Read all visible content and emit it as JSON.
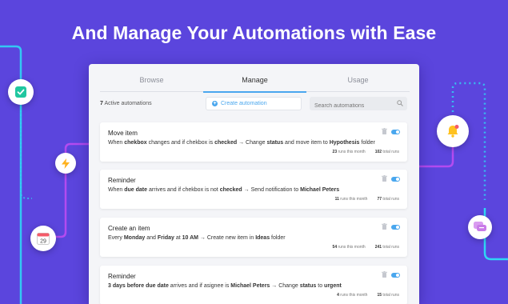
{
  "headline": "And Manage Your Automations with Ease",
  "tabs": [
    "Browse",
    "Manage",
    "Usage"
  ],
  "active_tab": "Manage",
  "count": {
    "number": "7",
    "label": " Active automations"
  },
  "create_label": "Create automation",
  "search_placeholder": "Search automations",
  "calendar_day": "29",
  "cards": [
    {
      "title": "Move item",
      "parts": [
        {
          "t": "When "
        },
        {
          "t": "chekbox",
          "b": true
        },
        {
          "t": " changes and if chekbox is "
        },
        {
          "t": "checked",
          "b": true
        },
        {
          "t": " → Change "
        },
        {
          "t": "status",
          "b": true
        },
        {
          "t": " and move item to "
        },
        {
          "t": "Hypothesis",
          "b": true
        },
        {
          "t": " folder"
        }
      ],
      "runs_month": "23",
      "runs_month_label": " runs this month",
      "runs_total": "102",
      "runs_total_label": " total runs"
    },
    {
      "title": "Reminder",
      "parts": [
        {
          "t": "When "
        },
        {
          "t": "due date",
          "b": true
        },
        {
          "t": " arrives and if chekbox is not "
        },
        {
          "t": "checked",
          "b": true
        },
        {
          "t": " → Send notification to "
        },
        {
          "t": "Michael Peters",
          "b": true
        }
      ],
      "runs_month": "11",
      "runs_month_label": " runs this month",
      "runs_total": "77",
      "runs_total_label": " total runs"
    },
    {
      "title": "Create an item",
      "parts": [
        {
          "t": "Every "
        },
        {
          "t": "Monday",
          "b": true
        },
        {
          "t": " and "
        },
        {
          "t": "Friday",
          "b": true
        },
        {
          "t": " at "
        },
        {
          "t": "10 AM",
          "b": true
        },
        {
          "t": " → Create new item in "
        },
        {
          "t": "Ideas",
          "b": true
        },
        {
          "t": " folder"
        }
      ],
      "runs_month": "54",
      "runs_month_label": " runs this month",
      "runs_total": "241",
      "runs_total_label": " total runs"
    },
    {
      "title": "Reminder",
      "parts": [
        {
          "t": "3 days before due date",
          "b": true
        },
        {
          "t": " arrives and if asignee is "
        },
        {
          "t": "Michael Peters",
          "b": true
        },
        {
          "t": " → Change "
        },
        {
          "t": "status",
          "b": true
        },
        {
          "t": " to "
        },
        {
          "t": "urgent",
          "b": true
        }
      ],
      "runs_month": "4",
      "runs_month_label": " runs this month",
      "runs_total": "15",
      "runs_total_label": " total runs"
    }
  ],
  "colors": {
    "background": "#5b45dd",
    "accent": "#4aa7ee",
    "cyan_line": "#2fd6f5",
    "magenta_line": "#b34bf0"
  },
  "icons": [
    "check-icon",
    "lightning-icon",
    "calendar-icon",
    "bell-icon",
    "chat-icon",
    "search-icon",
    "trash-icon",
    "plus-icon"
  ]
}
